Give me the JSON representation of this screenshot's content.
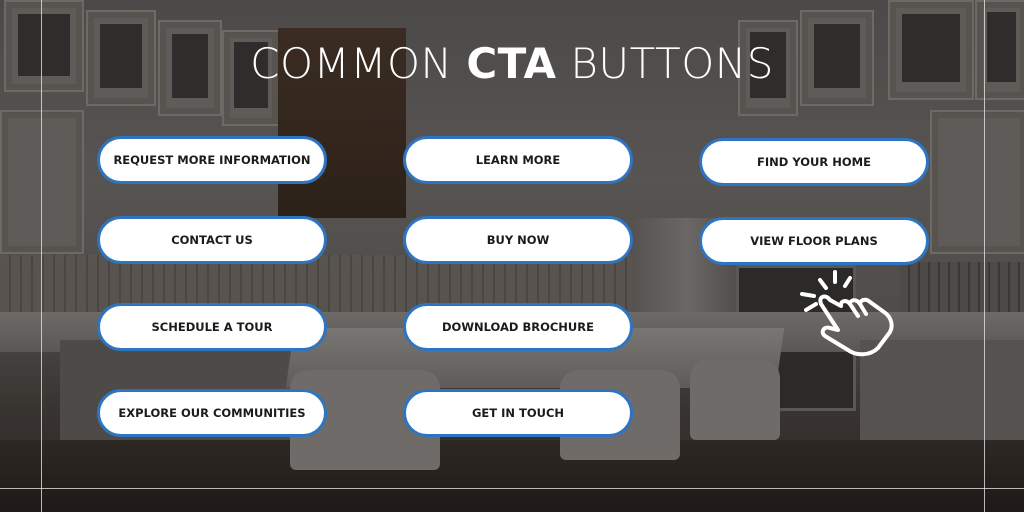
{
  "title": {
    "prefix": "COMMON ",
    "emphasis": "CTA",
    "suffix": " BUTTONS"
  },
  "colors": {
    "button_border": "#2f74c0",
    "button_fill": "#ffffff",
    "button_text": "#1b1b1b",
    "title_text": "#ffffff"
  },
  "buttons": [
    {
      "label": "REQUEST MORE INFORMATION"
    },
    {
      "label": "LEARN MORE"
    },
    {
      "label": "FIND YOUR HOME"
    },
    {
      "label": "CONTACT US"
    },
    {
      "label": "BUY NOW"
    },
    {
      "label": "VIEW FLOOR PLANS"
    },
    {
      "label": "SCHEDULE A TOUR"
    },
    {
      "label": "DOWNLOAD BROCHURE"
    },
    {
      "label": "EXPLORE OUR COMMUNITIES"
    },
    {
      "label": "GET IN TOUCH"
    }
  ],
  "icons": {
    "pointer": "hand-click-icon"
  }
}
